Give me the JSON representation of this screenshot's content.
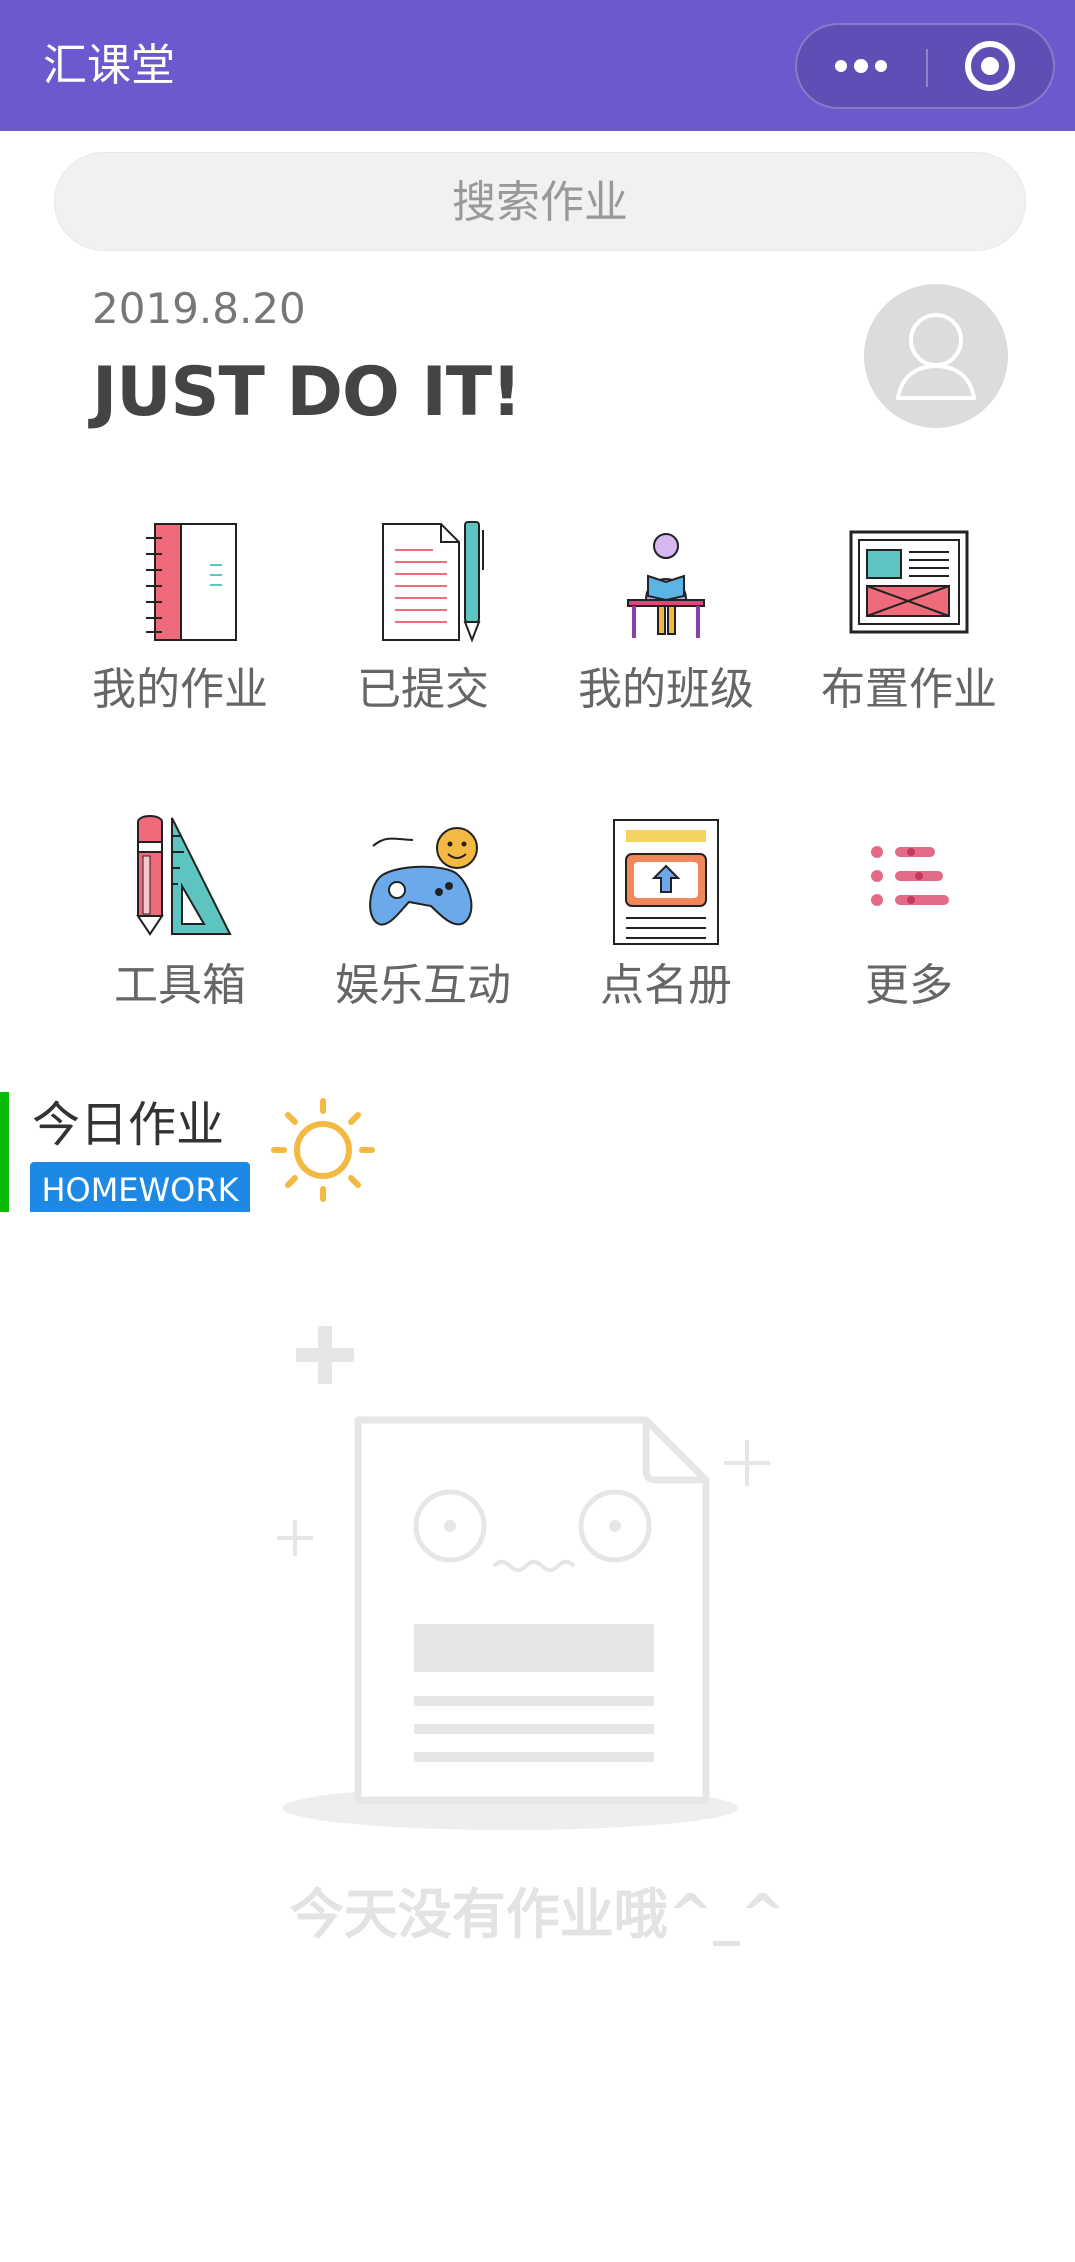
{
  "nav": {
    "title": "汇课堂",
    "bg_color": "#6a5acd"
  },
  "search": {
    "placeholder": "搜索作业"
  },
  "header": {
    "date": "2019.8.20",
    "slogan": "JUST DO IT!"
  },
  "grid": [
    {
      "label": "我的作业",
      "icon": "notebook-icon"
    },
    {
      "label": "已提交",
      "icon": "document-pen-icon"
    },
    {
      "label": "我的班级",
      "icon": "student-reading-icon"
    },
    {
      "label": "布置作业",
      "icon": "board-icon"
    },
    {
      "label": "工具箱",
      "icon": "pencil-ruler-icon"
    },
    {
      "label": "娱乐互动",
      "icon": "gamepad-icon"
    },
    {
      "label": "点名册",
      "icon": "upload-document-icon"
    },
    {
      "label": "更多",
      "icon": "list-icon"
    }
  ],
  "section": {
    "title": "今日作业",
    "badge": "HOMEWORK",
    "accent_color": "#09bb07",
    "badge_color": "#1e88e5"
  },
  "empty": {
    "message": "今天没有作业哦^_^"
  }
}
